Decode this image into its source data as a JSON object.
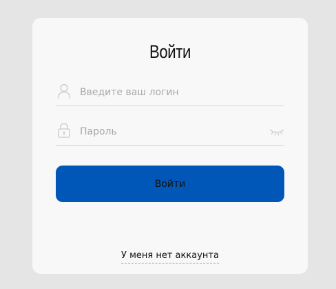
{
  "form": {
    "title": "Войти",
    "login": {
      "value": "",
      "placeholder": "Введите ваш логин",
      "icon": "user-icon"
    },
    "password": {
      "value": "",
      "placeholder": "Пароль",
      "icon": "lock-icon",
      "toggle_icon": "eye-closed-icon"
    },
    "submit_label": "Войти",
    "signup_link": "У меня нет аккаунта"
  },
  "colors": {
    "page_background": "#e5e5e5",
    "card_background": "#f8f8f8",
    "button": "#0057b8",
    "input_border": "#d3d3d3",
    "placeholder": "#a8a8a8"
  }
}
